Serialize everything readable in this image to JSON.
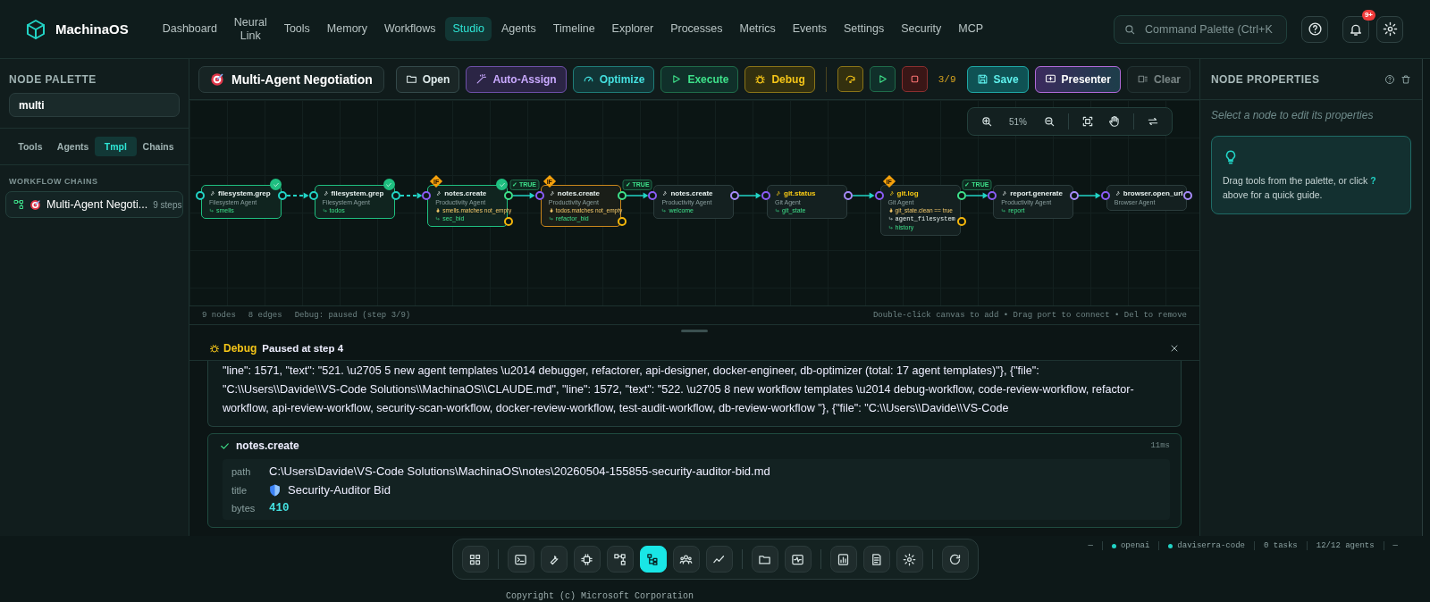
{
  "brand": "MachinaOS",
  "nav": [
    {
      "label": "Dashboard",
      "selected": false
    },
    {
      "label": "Neural Link",
      "selected": false
    },
    {
      "label": "Tools",
      "selected": false
    },
    {
      "label": "Memory",
      "selected": false
    },
    {
      "label": "Workflows",
      "selected": false
    },
    {
      "label": "Studio",
      "selected": true
    },
    {
      "label": "Agents",
      "selected": false
    },
    {
      "label": "Timeline",
      "selected": false
    },
    {
      "label": "Explorer",
      "selected": false
    },
    {
      "label": "Processes",
      "selected": false
    },
    {
      "label": "Metrics",
      "selected": false
    },
    {
      "label": "Events",
      "selected": false
    },
    {
      "label": "Settings",
      "selected": false
    },
    {
      "label": "Security",
      "selected": false
    },
    {
      "label": "MCP",
      "selected": false
    }
  ],
  "command_palette": {
    "placeholder": "Command Palette (Ctrl+K"
  },
  "notifications": {
    "badge": "9+"
  },
  "palette": {
    "title": "NODE PALETTE",
    "search": {
      "value": "multi"
    },
    "tabs": [
      {
        "label": "Tools",
        "selected": false
      },
      {
        "label": "Agents",
        "selected": false
      },
      {
        "label": "Tmpl",
        "selected": true
      },
      {
        "label": "Chains",
        "selected": false
      }
    ],
    "section": "WORKFLOW CHAINS",
    "items": [
      {
        "label": "Multi-Agent Negoti...",
        "meta": "9 steps"
      }
    ]
  },
  "workflow": {
    "title": "Multi-Agent Negotiation",
    "buttons": [
      {
        "label": "Open",
        "kind": "neutral"
      },
      {
        "label": "Auto-Assign",
        "kind": "violet"
      },
      {
        "label": "Optimize",
        "kind": "teal"
      },
      {
        "label": "Execute",
        "kind": "green"
      },
      {
        "label": "Debug",
        "kind": "amber"
      }
    ],
    "debug_controls": [
      {
        "kind": "step"
      },
      {
        "kind": "play"
      },
      {
        "kind": "stop"
      }
    ],
    "step_counter": "3/9",
    "actions": [
      {
        "label": "Save",
        "kind": "primary",
        "disabled": false
      },
      {
        "label": "Presenter",
        "kind": "presenter",
        "disabled": false
      },
      {
        "label": "Clear",
        "kind": "neutral",
        "disabled": true
      }
    ]
  },
  "zoom": {
    "level": "51%"
  },
  "graph": {
    "nodes": [
      {
        "title": "filesystem.grep",
        "agent": "Filesystem Agent",
        "output": "smells",
        "done": true,
        "paused": false,
        "color": "#e8f2f0"
      },
      {
        "title": "filesystem.grep",
        "agent": "Filesystem Agent",
        "output": "todos",
        "done": true,
        "paused": false,
        "color": "#e8f2f0"
      },
      {
        "title": "notes.create",
        "agent": "Productivity Agent",
        "badge": "IF",
        "condition": "smells.matches not_empty",
        "output": "sec_bid",
        "done": true,
        "paused": false,
        "color": "#e8f2f0"
      },
      {
        "title": "notes.create",
        "agent": "Productivity Agent",
        "badge": "IF",
        "condition": "todos.matches not_empty",
        "output": "refactor_bid",
        "done": false,
        "paused": true,
        "color": "#e8f2f0"
      },
      {
        "title": "notes.create",
        "agent": "Productivity Agent",
        "output": "welcome",
        "done": false,
        "paused": false,
        "color": "#e8f2f0"
      },
      {
        "title": "git.status",
        "agent": "Git Agent",
        "output": "git_state",
        "done": false,
        "paused": false,
        "color": "#facc15"
      },
      {
        "title": "git.log",
        "agent": "Git Agent",
        "badge": "IF",
        "condition": "git_state.clean == true",
        "route": "agent_filesystem",
        "output": "history",
        "done": false,
        "paused": false,
        "color": "#facc15"
      },
      {
        "title": "report.generate",
        "agent": "Productivity Agent",
        "output": "report",
        "done": false,
        "paused": false,
        "color": "#e8f2f0"
      },
      {
        "title": "browser.open_url",
        "agent": "Browser Agent",
        "done": false,
        "paused": false,
        "color": "#e8f2f0"
      }
    ],
    "edges": [
      {
        "kind": "dashed"
      },
      {
        "kind": "dashed"
      },
      {
        "kind": "solid",
        "label": "✓ TRUE"
      },
      {
        "kind": "solid",
        "label": "✓ TRUE"
      },
      {
        "kind": "solid"
      },
      {
        "kind": "solid"
      },
      {
        "kind": "solid",
        "label": "✓ TRUE"
      },
      {
        "kind": "solid"
      }
    ]
  },
  "canvas_footer": {
    "nodes": "9 nodes",
    "edges": "8 edges",
    "debug": "Debug: paused (step 3/9)",
    "hint": "Double-click canvas to add • Drag port to connect • Del to remove"
  },
  "debug_panel": {
    "title": "Debug",
    "status": "Paused at step 4",
    "output": "\"line\": 1571, \"text\": \"521. \\u2705 5 new agent templates \\u2014 debugger, refactorer, api-designer, docker-engineer, db-optimizer (total: 17 agent templates)\"}, {\"file\": \"C:\\\\Users\\\\Davide\\\\VS-Code Solutions\\\\MachinaOS\\\\CLAUDE.md\", \"line\": 1572, \"text\": \"522. \\u2705 8 new workflow templates \\u2014 debug-workflow, code-review-workflow, refactor-workflow, api-review-workflow, security-scan-workflow, docker-review-workflow, test-audit-workflow, db-review-workflow \"}, {\"file\": \"C:\\\\Users\\\\Davide\\\\VS-Code",
    "result": {
      "tool": "notes.create",
      "duration": "11ms",
      "fields": [
        {
          "key": "path",
          "value": "C:\\Users\\Davide\\VS-Code Solutions\\MachinaOS\\notes\\20260504-155855-security-auditor-bid.md",
          "kind": "text"
        },
        {
          "key": "title",
          "value": "Security-Auditor Bid",
          "kind": "shield"
        },
        {
          "key": "bytes",
          "value": "410",
          "kind": "number"
        }
      ]
    }
  },
  "properties": {
    "title": "NODE PROPERTIES",
    "empty": "Select a node to edit its properties",
    "tip": "Drag tools from the palette, or click **?** above for a quick guide."
  },
  "status_bar": [
    {
      "text": "—",
      "kind": "text"
    },
    {
      "text": "openai",
      "kind": "dot"
    },
    {
      "text": "daviserra-code",
      "kind": "dot"
    },
    {
      "text": "0 tasks",
      "kind": "text"
    },
    {
      "text": "12/12 agents",
      "kind": "text"
    },
    {
      "text": "—",
      "kind": "text"
    }
  ],
  "dock": {
    "groups": [
      [
        {
          "selected": false
        }
      ],
      [
        {
          "selected": false
        },
        {
          "selected": false
        },
        {
          "selected": false
        },
        {
          "selected": false
        },
        {
          "selected": true
        },
        {
          "selected": false
        },
        {
          "selected": false
        }
      ],
      [
        {
          "selected": false
        },
        {
          "selected": false
        }
      ],
      [
        {
          "selected": false
        },
        {
          "selected": false
        },
        {
          "selected": false
        }
      ],
      [
        {
          "selected": false
        }
      ]
    ]
  },
  "terminal": {
    "text": "Copyright (c) Microsoft Corporation"
  }
}
